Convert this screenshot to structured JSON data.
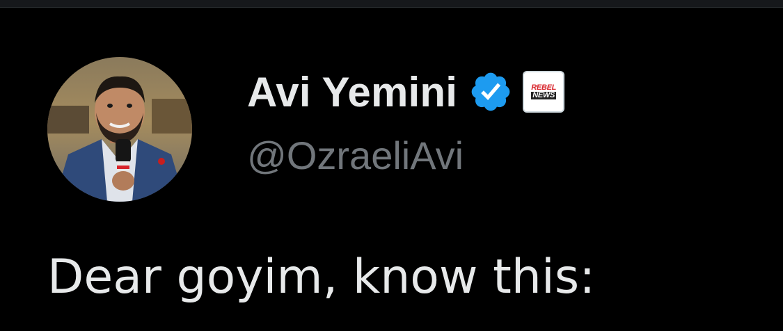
{
  "tweet": {
    "author": {
      "display_name": "Avi Yemini",
      "handle": "@OzraeliAvi",
      "verified_icon": "verified-badge-icon",
      "verified_color": "#1d9bf0",
      "affiliate_badge": {
        "icon": "rebel-news-logo",
        "line1": "REBEL",
        "line2": "NEWS"
      }
    },
    "text": "Dear goyim, know this:"
  },
  "theme": {
    "background": "#000000",
    "primary_text": "#e7e9ea",
    "secondary_text": "#71767b"
  }
}
